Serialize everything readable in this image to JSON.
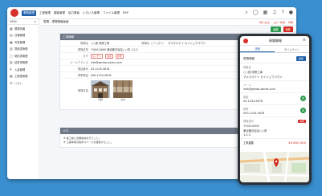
{
  "nav": {
    "items": [
      "業務管理",
      "工程管理",
      "顧客管理",
      "協力業者",
      "いろいろ管理",
      "ファイル管理",
      "ERP"
    ],
    "active_index": 0
  },
  "sidebar": {
    "header": "MENU",
    "items": [
      {
        "label": "現場情報"
      },
      {
        "label": "日報管理"
      },
      {
        "label": "写真管理"
      },
      {
        "label": "見積書管理"
      },
      {
        "label": "契約書管理"
      },
      {
        "label": "請求書管理"
      },
      {
        "label": "入金管理"
      },
      {
        "label": "工程表管理"
      },
      {
        "label": "リスト"
      }
    ]
  },
  "main": {
    "breadcrumb": "現場 - 現場情報画面",
    "links": [
      "一覧へ戻る",
      "コピー作成",
      "印刷"
    ],
    "buttons": [
      "編集",
      "削除"
    ],
    "card_title": "工事情報",
    "fields": [
      {
        "label": "現場名",
        "value": "○○邸 改修工事",
        "label2": "現場名（フリガナ）",
        "value2": "マルマルテイ カイシュウコウジ"
      },
      {
        "label": "現場住所",
        "value": "〒000-0000 東京都渋谷区○○町 1-2-3"
      },
      {
        "label": "タグ",
        "tags": [
          "キッチン",
          "浴室",
          "外壁"
        ]
      },
      {
        "label": "メールアドレス",
        "value": "info@genba-works.com"
      },
      {
        "label": "電話番号",
        "value": "03-1234-5678"
      },
      {
        "label": "携帯電話",
        "value": "090-1234-5678"
      }
    ],
    "photos_label": "現場写真",
    "photos": [
      {
        "caption": "外観"
      },
      {
        "caption": "室内"
      }
    ],
    "memo_title": "メモ",
    "memo_lines": [
      "※ 着工前に近隣挨拶を行うこと。",
      "※ 工事車両の駐車スペースを確保すること。"
    ]
  },
  "phone": {
    "title": "現場情報",
    "tabs": [
      "詳細",
      "タイムライン"
    ],
    "active_tab": 0,
    "section": "現場情報",
    "edit_label": "編集",
    "fields": [
      {
        "label": "現場名",
        "lines": [
          "○○邸 改修工事",
          "マルマルテイ カイシュウコウジ"
        ]
      },
      {
        "label": "メール",
        "lines": [
          "info@genba-works.com"
        ]
      },
      {
        "label": "電話",
        "lines": [
          "03-1234-5678"
        ],
        "call": true
      },
      {
        "label": "携帯",
        "lines": [
          "090-1234-5678"
        ],
        "call": true
      },
      {
        "label": "現場住所",
        "lines": [
          "〒000-0000",
          "東京都渋谷区○○町",
          "1-2-3"
        ],
        "map": "地図"
      }
    ],
    "price_label": "工事金額",
    "price": "¥3,850,000"
  },
  "colors": {
    "background": "#3a8fd0",
    "brand_red": "#d7322a",
    "accent_blue": "#1d5fa8",
    "success_green": "#2b9a4c",
    "card_header": "#6d7785"
  },
  "icons": {
    "top": [
      "search-icon",
      "chat-icon",
      "calendar-icon",
      "bell-icon",
      "help-icon",
      "user-icon"
    ],
    "sidebar": [
      "grid-icon",
      "document-icon",
      "image-icon",
      "calculator-icon",
      "file-icon",
      "invoice-icon",
      "yen-icon",
      "calendar-icon",
      "list-icon"
    ],
    "phone": [
      "menu-icon",
      "phone-icon",
      "map-pin-icon"
    ]
  }
}
